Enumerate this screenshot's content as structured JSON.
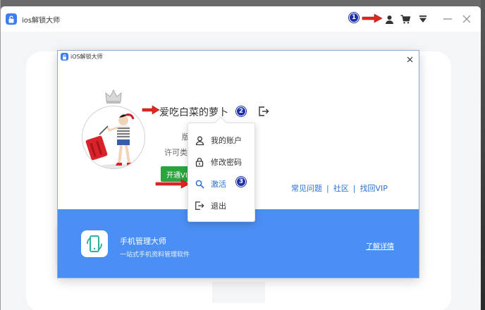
{
  "main_window": {
    "title": "ios解锁大师"
  },
  "dialog": {
    "title": "iOS解锁大师",
    "username": "爱吃白菜的萝卜",
    "version_label": "版",
    "license_label": "许可类",
    "vip_button": "开通VIP",
    "help_links": [
      "常见问题",
      "社区",
      "找回VIP"
    ],
    "help_separator": "|"
  },
  "banner": {
    "title": "手机管理大师",
    "subtitle": "一站式手机资料管理软件",
    "link": "了解详情"
  },
  "menu": {
    "items": [
      {
        "label": "我的账户",
        "icon": "user-icon"
      },
      {
        "label": "修改密码",
        "icon": "lock-icon"
      },
      {
        "label": "激活",
        "icon": "search-icon"
      },
      {
        "label": "退出",
        "icon": "logout-icon"
      }
    ]
  },
  "annotations": {
    "badges": [
      "1",
      "2",
      "3"
    ]
  },
  "colors": {
    "accent": "#4b8ff5",
    "link": "#2c6fd6",
    "vip_green": "#2aa53d",
    "annotation_arrow": "#e0261f",
    "annotation_badge": "#1a2fa8"
  }
}
